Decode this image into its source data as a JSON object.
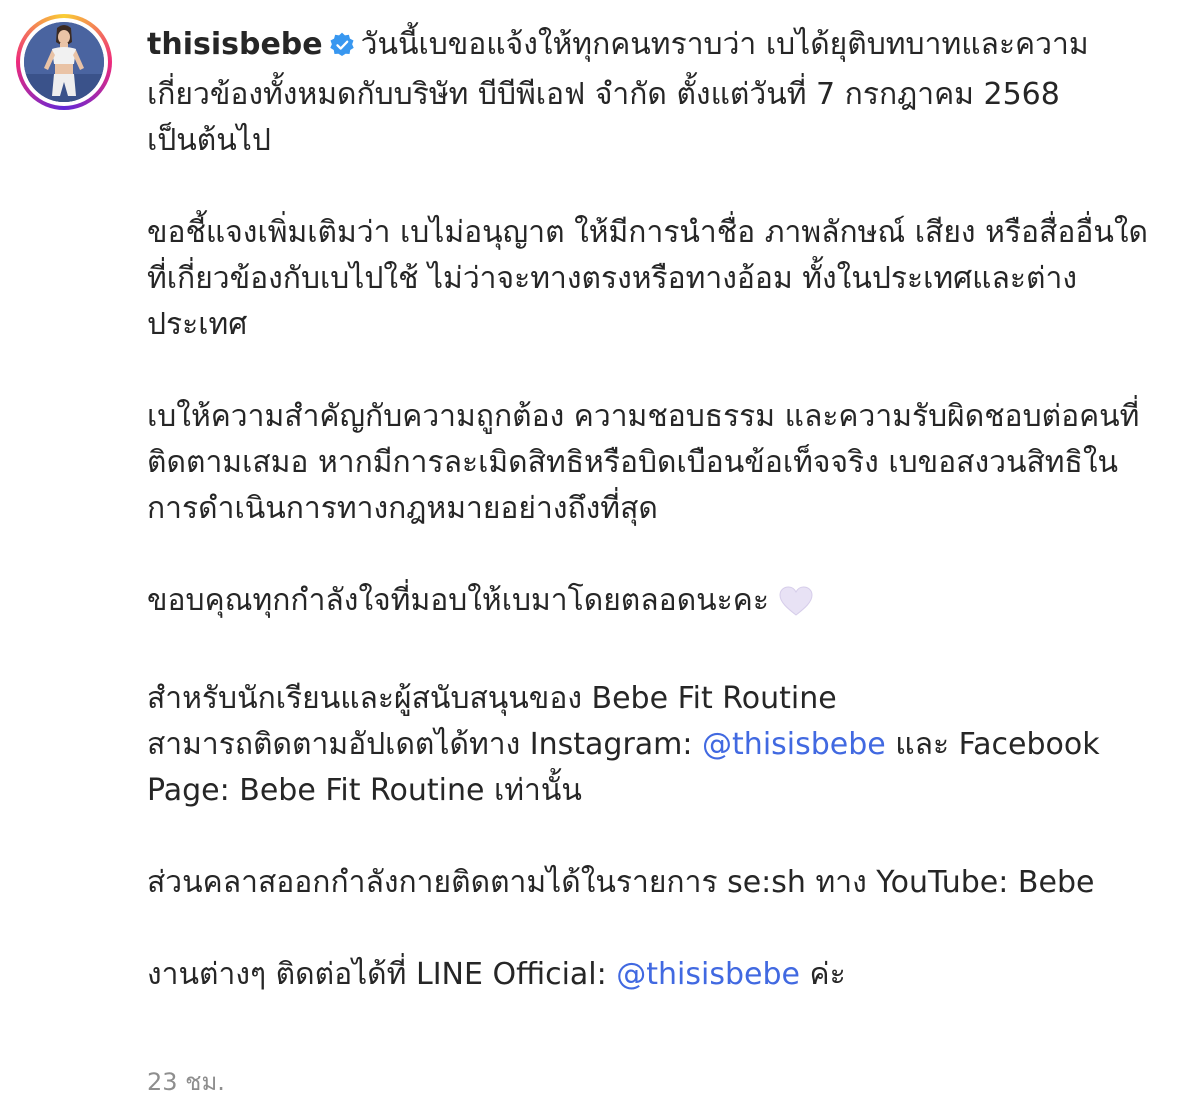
{
  "post": {
    "username": "thisisbebe",
    "paragraphs": {
      "p1": "วันนี้เบขอแจ้งให้ทุกคนทราบว่า เบได้ยุติบทบาทและความเกี่ยวข้องทั้งหมดกับบริษัท บีบีพีเอฟ จำกัด ตั้งแต่วันที่ 7 กรกฎาคม 2568 เป็นต้นไป",
      "p2": "ขอชี้แจงเพิ่มเติมว่า เบไม่อนุญาต ให้มีการนำชื่อ ภาพลักษณ์ เสียง หรือสื่ออื่นใดที่เกี่ยวข้องกับเบไปใช้ ไม่ว่าจะทางตรงหรือทางอ้อม ทั้งในประเทศและต่างประเทศ",
      "p3": "เบให้ความสำคัญกับความถูกต้อง ความชอบธรรม และความรับผิดชอบต่อคนที่ติดตามเสมอ หากมีการละเมิดสิทธิหรือบิดเบือนข้อเท็จจริง เบขอสงวนสิทธิในการดำเนินการทางกฎหมายอย่างถึงที่สุด",
      "p4": "ขอบคุณทุกกำลังใจที่มอบให้เบมาโดยตลอดนะคะ",
      "p5_line1": "สำหรับนักเรียนและผู้สนับสนุนของ Bebe Fit Routine",
      "p5_line2_a": "สามารถติดตามอัปเดตได้ทาง Instagram: ",
      "p5_line2_mention": "@thisisbebe",
      "p5_line2_b": " และ Facebook Page: Bebe Fit Routine เท่านั้น",
      "p6": "ส่วนคลาสออกกำลังกายติดตามได้ในรายการ se:sh ทาง YouTube: Bebe",
      "p7_a": "งานต่างๆ ติดต่อได้ที่ LINE Official: ",
      "p7_mention": "@thisisbebe",
      "p7_b": " ค่ะ"
    },
    "timestamp": "23 ชม."
  },
  "icons": {
    "verified": "verified-badge-icon",
    "heart": "white-heart-emoji-icon",
    "avatar": "profile-photo"
  },
  "colors": {
    "text": "#262626",
    "mention": "#4169e1",
    "verified": "#3897f0",
    "timestamp": "#8e8e8e",
    "heart": "#e8e2f5"
  }
}
